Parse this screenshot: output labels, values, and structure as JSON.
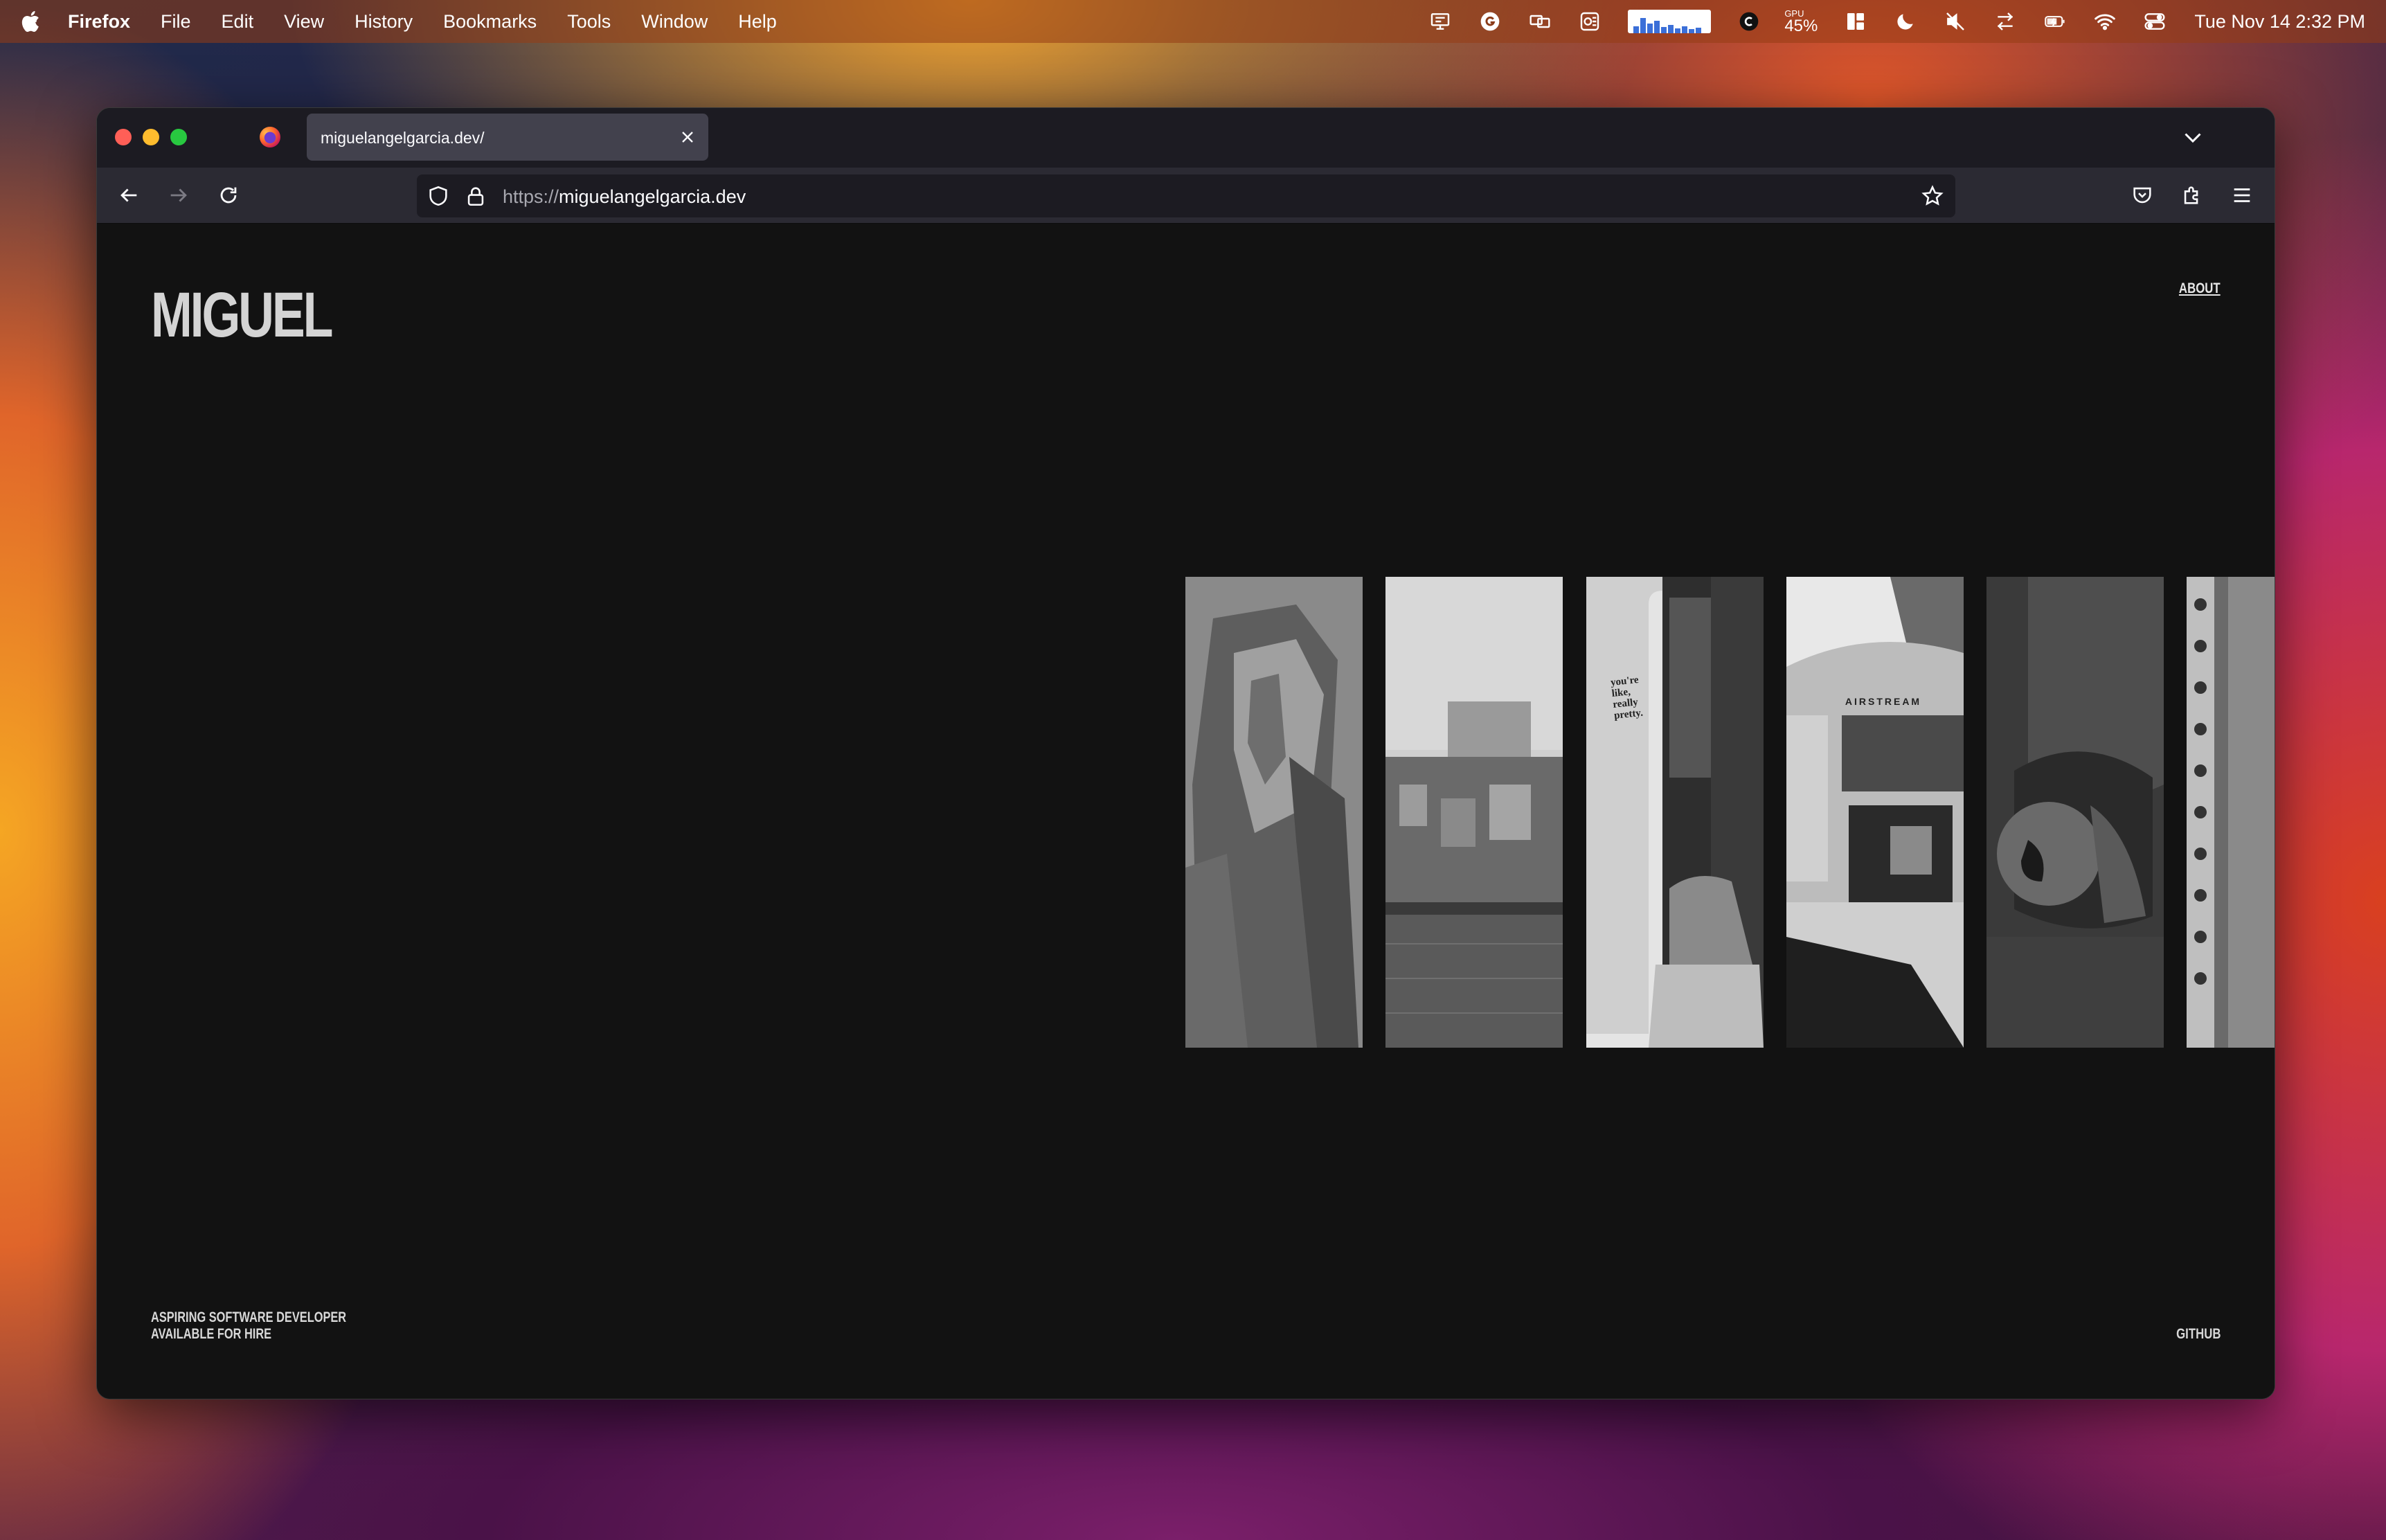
{
  "menubar": {
    "app_name": "Firefox",
    "items": [
      "File",
      "Edit",
      "View",
      "History",
      "Bookmarks",
      "Tools",
      "Window",
      "Help"
    ],
    "gpu_label": "GPU",
    "gpu_value": "45%",
    "clock": "Tue Nov 14  2:32 PM",
    "tray_icons": [
      "presentation-icon",
      "grammarly-icon",
      "screens-icon",
      "outlook-icon",
      "cpu-graph",
      "chatgpt-icon",
      "gpu-meter",
      "layout-icon",
      "moon-icon",
      "mute-icon",
      "transfer-icon",
      "battery-icon",
      "wifi-icon",
      "control-center-icon"
    ]
  },
  "browser": {
    "tab_title": "miguelangelgarcia.dev/",
    "url_scheme": "https://",
    "url_host": "miguelangelgarcia.dev"
  },
  "page": {
    "logo": "MIGUEL",
    "nav_about": "ABOUT",
    "footer_line1": "ASPIRING SOFTWARE DEVELOPER",
    "footer_line2": "AVAILABLE FOR HIRE",
    "footer_github": "GITHUB",
    "photo_text_mirror": "you're like, really pretty.",
    "photo_text_airstream": "AIRSTREAM",
    "photos": [
      "statue",
      "porto-riverside",
      "mirror-sign",
      "airstream-trailer",
      "closeup",
      "cathedral-column"
    ]
  },
  "colors": {
    "page_bg": "#121212",
    "toolbar_bg": "#2b2a33",
    "tab_bg": "#42414d",
    "logo": "#d4d4d4"
  }
}
